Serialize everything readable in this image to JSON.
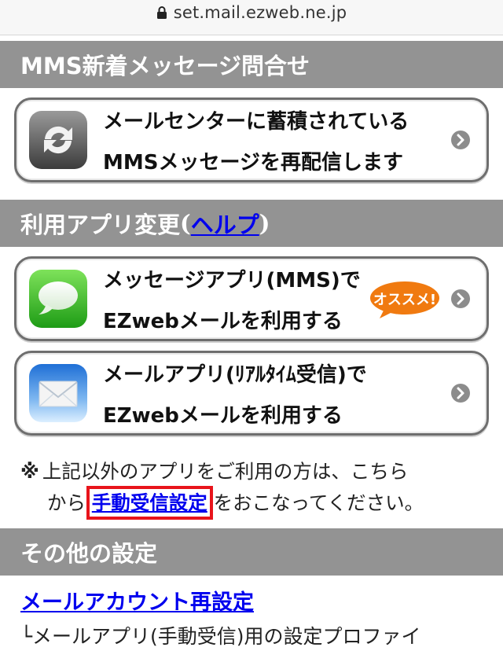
{
  "browser": {
    "url": "set.mail.ezweb.ne.jp"
  },
  "sections": {
    "mms": {
      "title": "MMS新着メッセージ問合せ"
    },
    "app_change": {
      "title_prefix": "利用アプリ変更",
      "paren_open": "(",
      "help_label": "ヘルプ",
      "paren_close": ")"
    },
    "other": {
      "title": "その他の設定"
    }
  },
  "cards": {
    "resend": {
      "line1": "メールセンターに蓄積されている",
      "line2": "MMSメッセージを再配信します",
      "icon": "refresh-arrows-icon"
    },
    "messages_app": {
      "line1": "メッセージアプリ(MMS)で",
      "line2": "EZwebメールを利用する",
      "badge": "オススメ!",
      "icon": "speech-bubble-icon"
    },
    "mail_app": {
      "line1": "メールアプリ(ﾘｱﾙﾀｲﾑ受信)で",
      "line2": "EZwebメールを利用する",
      "icon": "envelope-icon"
    }
  },
  "note": {
    "mark": "※",
    "line1": "上記以外のアプリをご利用の方は、こちら",
    "line2_prefix": "から",
    "link": "手動受信設定",
    "line2_suffix": "をおこなってください。"
  },
  "other": {
    "account_link": "メールアカウント再設定",
    "description": "└メールアプリ(手動受信)用の設定プロファイ"
  },
  "colors": {
    "header_gray": "#939393",
    "link_blue": "#0000ee",
    "highlight_red": "#e8141b",
    "badge_orange": "#f07a10"
  }
}
